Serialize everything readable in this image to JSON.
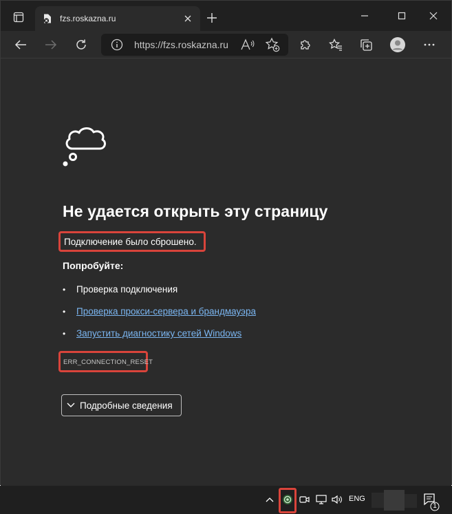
{
  "browser": {
    "tab": {
      "title": "fzs.roskazna.ru"
    },
    "address_bar": {
      "url": "https://fzs.roskazna.ru"
    }
  },
  "page": {
    "title": "Не удается открыть эту страницу",
    "message": "Подключение было сброшено.",
    "try_heading": "Попробуйте:",
    "suggestions": [
      {
        "text": "Проверка подключения",
        "is_link": false
      },
      {
        "text": "Проверка прокси-сервера и брандмауэра",
        "is_link": true
      },
      {
        "text": "Запустить диагностику сетей Windows",
        "is_link": true
      }
    ],
    "error_code": "ERR_CONNECTION_RESET",
    "details_button": "Подробные сведения"
  },
  "taskbar": {
    "language": "ENG",
    "notification_count": "1"
  },
  "colors": {
    "background": "#2b2b2b",
    "titlebar": "#202020",
    "link": "#7bb6f1",
    "highlight": "#d9443b",
    "taskbar": "#1f1f1f"
  }
}
